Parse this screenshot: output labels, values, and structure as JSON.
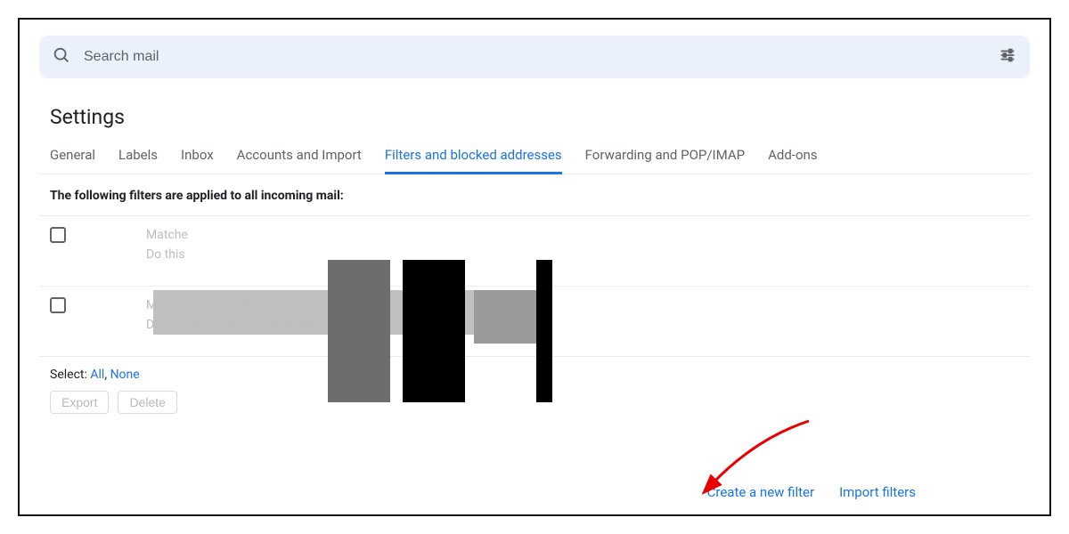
{
  "search": {
    "placeholder": "Search mail"
  },
  "page_title": "Settings",
  "tabs": [
    {
      "label": "General"
    },
    {
      "label": "Labels"
    },
    {
      "label": "Inbox"
    },
    {
      "label": "Accounts and Import"
    },
    {
      "label": "Filters and blocked addresses",
      "active": true
    },
    {
      "label": "Forwarding and POP/IMAP"
    },
    {
      "label": "Add-ons"
    }
  ],
  "filters_heading": "The following filters are applied to all incoming mail:",
  "filters": [
    {
      "matches_label": "Matche",
      "matches_value": "",
      "do_label": "Do this",
      "do_value": ""
    },
    {
      "matches_label": "Matches:",
      "matches_value": "from:(mroyster@royster.com)",
      "do_label": "Do this:",
      "do_value": "Never send it to Spam"
    }
  ],
  "select": {
    "label": "Select:",
    "all": "All",
    "comma": ",",
    "none": "None"
  },
  "buttons": {
    "export": "Export",
    "delete": "Delete"
  },
  "links": {
    "create": "Create a new filter",
    "import": "Import filters"
  }
}
